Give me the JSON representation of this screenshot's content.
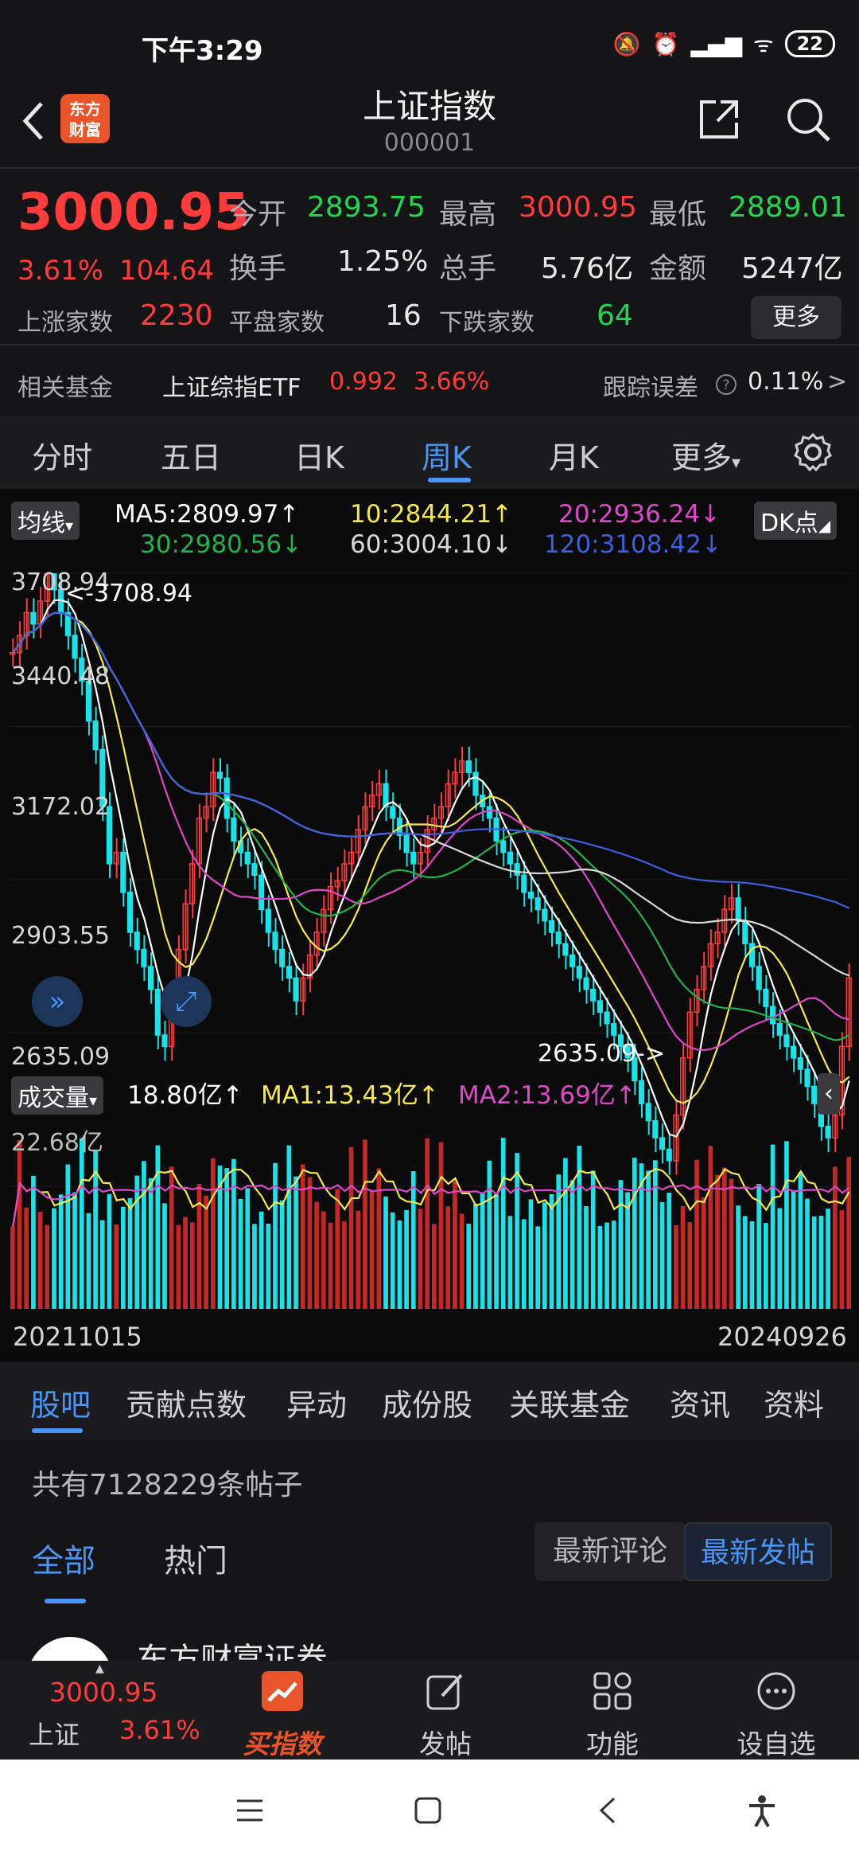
{
  "status": {
    "time": "下午3:29",
    "battery": "22"
  },
  "header": {
    "title": "上证指数",
    "code": "000001",
    "logo_text_1": "东方",
    "logo_text_2": "财富"
  },
  "quote": {
    "price": "3000.95",
    "change_pct": "3.61%",
    "change": "104.64",
    "open_label": "今开",
    "open": "2893.75",
    "high_label": "最高",
    "high": "3000.95",
    "low_label": "最低",
    "low": "2889.01",
    "turnover_label": "换手",
    "turnover": "1.25%",
    "volume_label": "总手",
    "volume": "5.76亿",
    "amount_label": "金额",
    "amount": "5247亿",
    "up_label": "上涨家数",
    "up": "2230",
    "flat_label": "平盘家数",
    "flat": "16",
    "down_label": "下跌家数",
    "down": "64",
    "more": "更多"
  },
  "fund": {
    "label": "相关基金",
    "name": "上证综指ETF",
    "price": "0.992",
    "pct": "3.66%",
    "err_label": "跟踪误差",
    "err": "0.11%",
    "arrow": ">"
  },
  "tabs": [
    "分时",
    "五日",
    "日K",
    "周K",
    "月K",
    "更多"
  ],
  "ma": {
    "pill": "均线",
    "dk": "DK点",
    "ma5": "MA5:2809.97",
    "ma10": "10:2844.21",
    "ma20": "20:2936.24",
    "ma30": "30:2980.56",
    "ma60": "60:3004.10",
    "ma120": "120:3108.42",
    "up": "↑",
    "down": "↓"
  },
  "price_axis": [
    "3708.94",
    "3440.48",
    "3172.02",
    "2903.55",
    "2635.09"
  ],
  "annotations": {
    "high": "<-3708.94",
    "low": "2635.09->"
  },
  "volume": {
    "pill": "成交量",
    "vol": "18.80亿",
    "ma1": "MA1:13.43亿",
    "ma2": "MA2:13.69亿",
    "max": "22.68亿",
    "up": "↑"
  },
  "dates": {
    "start": "20211015",
    "end": "20240926"
  },
  "subtabs": [
    "股吧",
    "贡献点数",
    "异动",
    "成份股",
    "关联基金",
    "资讯",
    "资料"
  ],
  "forum": {
    "count": "共有7128229条帖子",
    "tab_all": "全部",
    "tab_hot": "热门",
    "seg_comment": "最新评论",
    "seg_post": "最新发帖",
    "first_author": "东方财富证券"
  },
  "bottomnav": {
    "index_price": "3000.95",
    "index_name": "上证",
    "index_pct": "3.61%",
    "buy": "买指数",
    "post": "发帖",
    "func": "功能",
    "fav": "设自选"
  },
  "colors": {
    "up": "#ff3b3b",
    "down": "#1fd84f",
    "accent": "#4a95f5",
    "ma5": "#ffffff",
    "ma10": "#f5e94a",
    "ma20": "#e046c8",
    "ma30": "#22b24a",
    "ma60": "#d8d8d8",
    "ma120": "#3f5ee0"
  },
  "chart_data": {
    "type": "candlestick",
    "period": "weekly",
    "x_range": [
      "20211015",
      "20240926"
    ],
    "ylim": [
      2635.09,
      3708.94
    ],
    "price_ticks": [
      3708.94,
      3440.48,
      3172.02,
      2903.55,
      2635.09
    ],
    "close": [
      3570,
      3600,
      3640,
      3620,
      3660,
      3708,
      3680,
      3640,
      3600,
      3560,
      3520,
      3450,
      3400,
      3300,
      3200,
      3220,
      3150,
      3080,
      3050,
      3020,
      2980,
      2900,
      2880,
      2950,
      3050,
      3130,
      3200,
      3280,
      3300,
      3360,
      3350,
      3280,
      3240,
      3220,
      3200,
      3180,
      3120,
      3080,
      3050,
      3020,
      3000,
      2960,
      3000,
      3040,
      3080,
      3120,
      3160,
      3170,
      3200,
      3220,
      3260,
      3300,
      3320,
      3340,
      3300,
      3280,
      3250,
      3220,
      3200,
      3220,
      3260,
      3280,
      3300,
      3340,
      3360,
      3380,
      3360,
      3320,
      3300,
      3280,
      3240,
      3220,
      3200,
      3180,
      3150,
      3140,
      3120,
      3100,
      3080,
      3060,
      3040,
      3020,
      3000,
      2980,
      2960,
      2940,
      2920,
      2900,
      2880,
      2860,
      2820,
      2780,
      2750,
      2720,
      2700,
      2680,
      2760,
      2860,
      2940,
      2980,
      3020,
      3060,
      3080,
      3120,
      3140,
      3100,
      3060,
      3020,
      2980,
      2950,
      2920,
      2900,
      2880,
      2860,
      2840,
      2810,
      2780,
      2740,
      2720,
      2760,
      2880,
      3000
    ],
    "volume_max": "22.68亿",
    "last_volume": "18.80亿"
  }
}
